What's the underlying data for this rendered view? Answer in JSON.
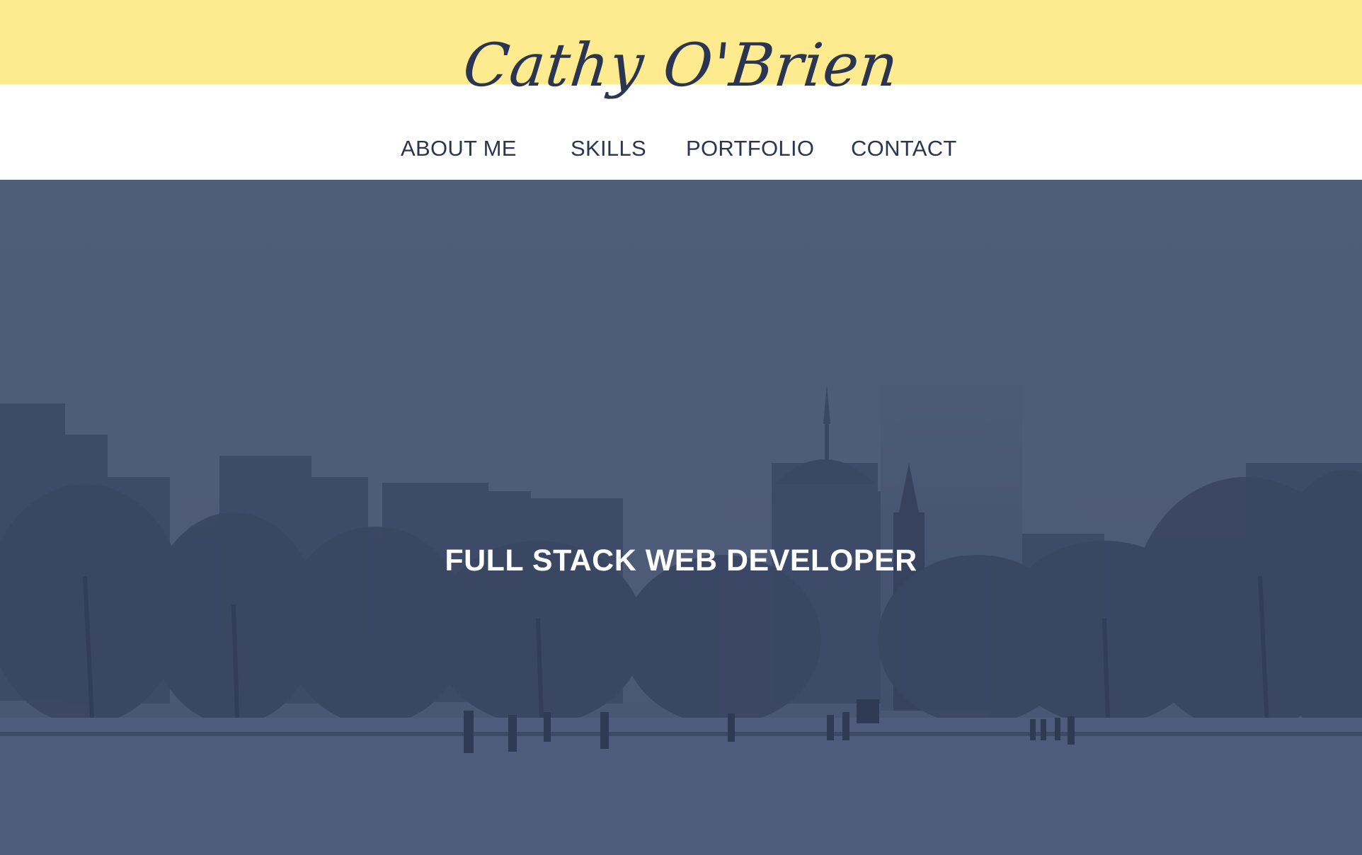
{
  "header": {
    "logo_text": "Cathy O'Brien",
    "nav": [
      {
        "label": "ABOUT ME"
      },
      {
        "label": "SKILLS"
      },
      {
        "label": "PORTFOLIO"
      },
      {
        "label": "CONTACT"
      }
    ]
  },
  "hero": {
    "title": "FULL STACK WEB DEVELOPER",
    "background_image": "snowy-city-park-skyline"
  },
  "colors": {
    "accent_yellow": "#feea8f",
    "navy": "#2a3552",
    "hero_overlay": "#4e5c7a",
    "hero_text": "#ffffff"
  }
}
